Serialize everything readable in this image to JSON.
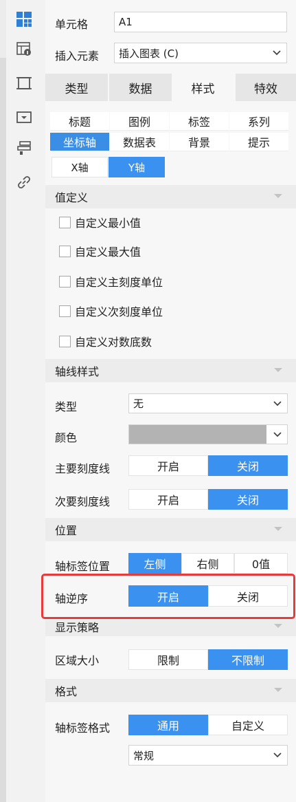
{
  "rail": {
    "icons": [
      "grid-icon",
      "table-info-icon",
      "frame-icon",
      "widget-icon",
      "layers-icon",
      "link-icon"
    ]
  },
  "cell": {
    "label": "单元格",
    "value": "A1"
  },
  "insert": {
    "label": "插入元素",
    "value": "插入图表 (C)"
  },
  "tabs": [
    "类型",
    "数据",
    "样式",
    "特效"
  ],
  "subtabs": [
    "标题",
    "图例",
    "标签",
    "系列",
    "坐标轴",
    "数据表",
    "背景",
    "提示"
  ],
  "axis_tabs": [
    "X轴",
    "Y轴"
  ],
  "value_section": {
    "title": "值定义",
    "checkboxes": [
      "自定义最小值",
      "自定义最大值",
      "自定义主刻度单位",
      "自定义次刻度单位",
      "自定义对数底数"
    ]
  },
  "axis_style": {
    "title": "轴线样式",
    "type_label": "类型",
    "type_value": "无",
    "color_label": "颜色",
    "color_value": "#b3b3b3",
    "major_label": "主要刻度线",
    "major_on": "开启",
    "major_off": "关闭",
    "minor_label": "次要刻度线",
    "minor_on": "开启",
    "minor_off": "关闭"
  },
  "position": {
    "title": "位置",
    "label_pos_label": "轴标签位置",
    "label_pos_options": [
      "左侧",
      "右侧",
      "0值"
    ],
    "reverse_label": "轴逆序",
    "reverse_on": "开启",
    "reverse_off": "关闭"
  },
  "display": {
    "title": "显示策略",
    "area_label": "区域大小",
    "area_limit": "限制",
    "area_nolimit": "不限制"
  },
  "format": {
    "title": "格式",
    "label_format_label": "轴标签格式",
    "general": "通用",
    "custom": "自定义",
    "select_value": "常规"
  },
  "colors": {
    "accent": "#3b91f0",
    "highlight": "#e53b3b",
    "icon": "#2f7fd6"
  }
}
